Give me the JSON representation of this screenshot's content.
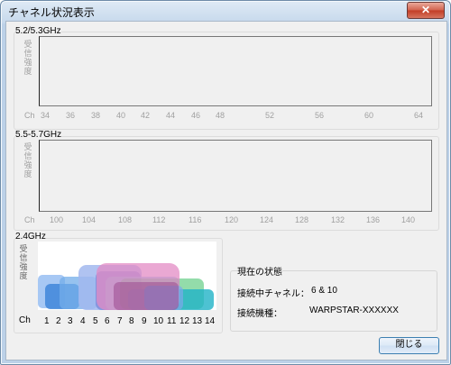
{
  "window": {
    "title": "チャネル状況表示"
  },
  "sections": {
    "band52": {
      "label": "5.2/5.3GHz"
    },
    "band55": {
      "label": "5.5-5.7GHz"
    },
    "band24": {
      "label": "2.4GHz"
    }
  },
  "y_axis_label": "受信強度",
  "ch_label": "Ch",
  "axes": {
    "band52": [
      "34",
      "36",
      "38",
      "40",
      "42",
      "44",
      "46",
      "48",
      "52",
      "56",
      "60",
      "64"
    ],
    "band55": [
      "100",
      "104",
      "108",
      "112",
      "116",
      "120",
      "124",
      "128",
      "132",
      "136",
      "140"
    ],
    "band24": [
      "1",
      "2",
      "3",
      "4",
      "5",
      "6",
      "7",
      "8",
      "9",
      "10",
      "11",
      "12",
      "13",
      "14"
    ]
  },
  "status": {
    "title": "現在の状態",
    "channel_label": "接続中チャネル：",
    "channel_value": "6 & 10",
    "device_label": "接続機種：",
    "device_value": "WARPSTAR-XXXXXX"
  },
  "buttons": {
    "close_title": "✕",
    "close": "閉じる"
  },
  "colors": {
    "pink": "#d7589a",
    "blue": "#3f86d9",
    "cyan": "#20b3c7",
    "green": "#3ac064"
  }
}
